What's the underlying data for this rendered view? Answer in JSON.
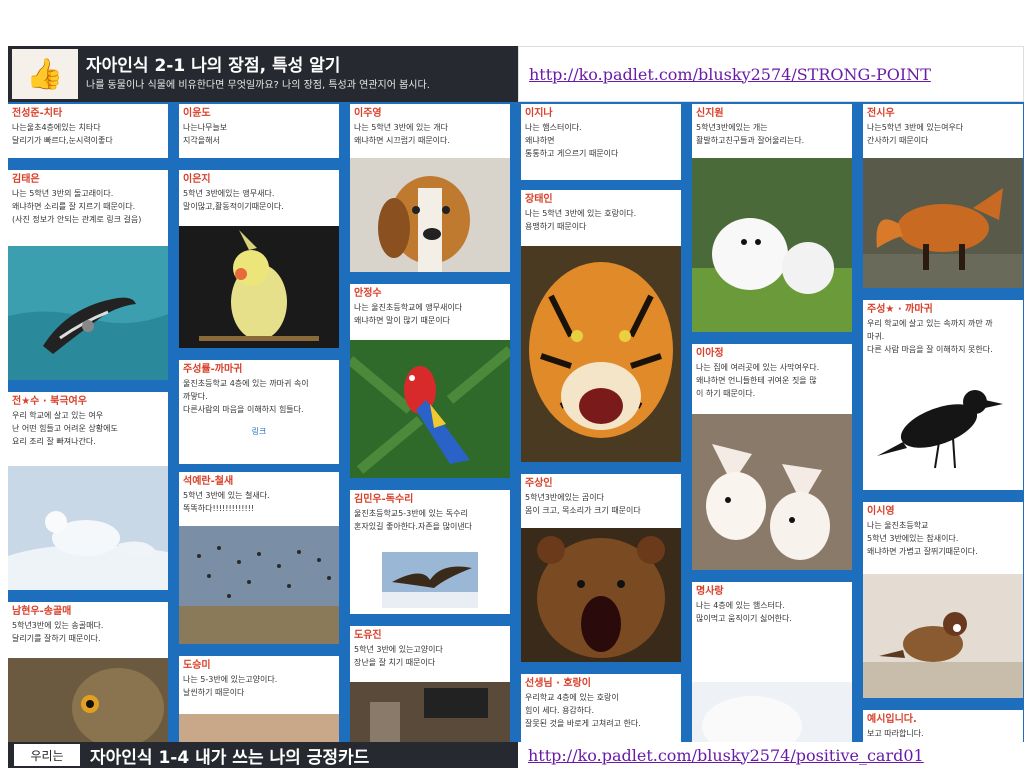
{
  "header": {
    "title": "자아인식 2-1 나의 장점, 특성 알기",
    "subtitle": "나를 동물이나 식물에 비유한다면 무엇일까요? 나의 장점, 특성과 연관지어 봅시다.",
    "url": "http://ko.padlet.com/blusky2574/STRONG-POINT"
  },
  "cards": [
    {
      "title": "전성준-치타",
      "lines": [
        "나는울초4층에있는 치타다",
        "달리기가 빠르다,눈시력이좋다"
      ]
    },
    {
      "title": "김태은",
      "lines": [
        "나는 5학년 3반의 돌고래이다.",
        "왜냐하면 소리를 잘 지르기 때문이다.",
        "(사진 정보가 안되는 관계로 링크 걸음)"
      ]
    },
    {
      "title": "전★수 · 북극여우",
      "lines": [
        "우리 학교에 살고 있는 여우",
        "난 어떤 힘들고 어려운 상황에도",
        "요리 조리 잘 빠져나간다."
      ]
    },
    {
      "title": "남현우-송골매",
      "lines": [
        "5학년3반에 있는 송골매다.",
        "달리기를 잘하기 때문이다."
      ]
    },
    {
      "title": "이윤도",
      "lines": [
        "나는나무늘보",
        "지각을해서"
      ]
    },
    {
      "title": "이은지",
      "lines": [
        "5학년 3반에있는 앵무새다.",
        "말이많고,활동적이기때문이다."
      ]
    },
    {
      "title": "주성률-까마귀",
      "lines": [
        "울진초등학교 4층에 있는 까마귀 속이",
        "까맣다.",
        "다른사람의 마음을 이해하지 힘들다."
      ],
      "link": "링크"
    },
    {
      "title": "석예란-철새",
      "lines": [
        "5학년 3반에 있는 철새다.",
        "똑똑하다!!!!!!!!!!!!!"
      ]
    },
    {
      "title": "도승미",
      "lines": [
        "나는 5-3반에 있는고양이다.",
        "날씬하기 때문이다"
      ]
    },
    {
      "title": "이주영",
      "lines": [
        "나는 5학년 3반에 있는 개다",
        "왜냐하면 시끄럽기 때문이다."
      ]
    },
    {
      "title": "안정수",
      "lines": [
        "나는 울진초등학교에 앵무새이다",
        "왜냐하면 말이 많기 때문이다"
      ]
    },
    {
      "title": "김민우-독수리",
      "lines": [
        "울진초등학교5-3반에 있는 독수리",
        "혼자있길 좋아한다.자존을 많이낸다"
      ]
    },
    {
      "title": "도유진",
      "lines": [
        "5학년 3반에 있는고양이다",
        "장난을 잘 치기 때문이다"
      ]
    },
    {
      "title": "이지나",
      "lines": [
        "나는 햄스터이다.",
        "왜냐하면",
        "통통하고  게으르기 때문이다"
      ]
    },
    {
      "title": "장태인",
      "lines": [
        "나는 5학년 3반에 있는 호랑이다.",
        "용맹하기 때문이다"
      ]
    },
    {
      "title": "주상인",
      "lines": [
        "5학년3반에있는 곰이다",
        "몸이 크고, 목소리가 크기 때문이다"
      ]
    },
    {
      "title": "선생님 · 호랑이",
      "lines": [
        "우리학교 4층에 있는 호랑이",
        "힘이 세다. 용감하다.",
        "잘못된 것을 바로게 고쳐려고 한다."
      ]
    },
    {
      "title": "신지원",
      "lines": [
        "5학년3반에있는 개는",
        "활발하고친구들과 잘어울리는다."
      ]
    },
    {
      "title": "이아정",
      "lines": [
        "나는 집에 여러곳에 있는 사막여우다.",
        "왜냐하면 언니들한테 귀여운 짓을 많",
        "이 하기 때문이다."
      ]
    },
    {
      "title": "명사랑",
      "lines": [
        "나는 4층에 있는 햄스터다.",
        "많이먹고 움직이기 싫어한다."
      ]
    },
    {
      "title": "전시우",
      "lines": [
        "나는5학년 3반에 있는여우다",
        "간사하기 때문이다"
      ]
    },
    {
      "title": "주성★ · 까마귀",
      "lines": [
        "우리 학교에 살고 있는 속까지 까만 까",
        "마귀.",
        "다른 사람 마음을 잘 이해하지 못한다."
      ]
    },
    {
      "title": "이시영",
      "lines": [
        "나는 울진초등학교",
        "5학년 3반에있는 참새이다.",
        "왜냐하면 가볍고 잘뛰기때문이다."
      ]
    },
    {
      "title": "예시입니다.",
      "lines": [
        "보고 따라합니다."
      ]
    }
  ],
  "footer": {
    "logo_text": "우리는",
    "title": "자아인식 1-4 내가 쓰는 나의 긍정카드",
    "url": "http://ko.padlet.com/blusky2574/positive_card01"
  },
  "icons": {
    "header_thumb": "thumbs-up-icon"
  },
  "colors": {
    "board_bg": "#1d6fbd",
    "header_bg": "#262a30",
    "card_title": "#d8402a",
    "link": "#6a1aa8"
  }
}
